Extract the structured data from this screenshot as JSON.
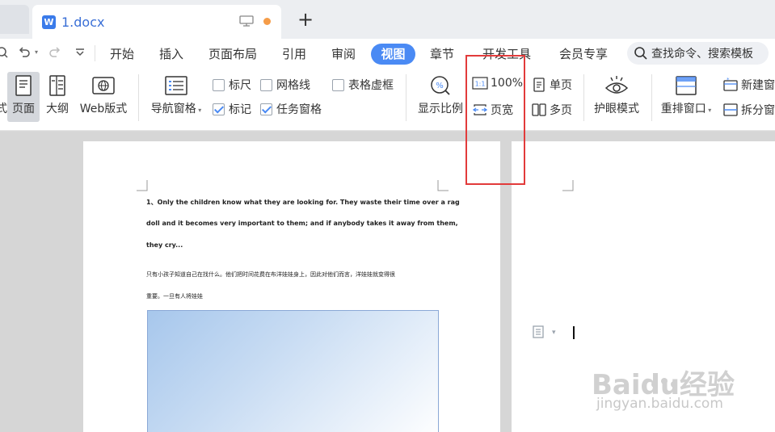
{
  "tabbar": {
    "doc_title": "1.docx",
    "add_tab": "+"
  },
  "menu": {
    "items": [
      "开始",
      "插入",
      "页面布局",
      "引用",
      "审阅",
      "视图",
      "章节",
      "开发工具",
      "会员专享"
    ],
    "active": "视图",
    "search_placeholder": "查找命令、搜索模板"
  },
  "ribbon": {
    "partial_left": "式",
    "page": "页面",
    "outline": "大纲",
    "web": "Web版式",
    "nav_pane": "导航窗格",
    "ruler": "标尺",
    "gridlines": "网格线",
    "table_gridlines": "表格虚框",
    "marks": "标记",
    "task_pane": "任务窗格",
    "zoom": "显示比例",
    "zoom_100": "100%",
    "page_width": "页宽",
    "single_page": "单页",
    "multi_page": "多页",
    "eye_mode": "护眼模式",
    "rearrange": "重排窗口",
    "new_window": "新建窗",
    "split_window": "拆分窗",
    "checks": {
      "ruler": false,
      "gridlines": false,
      "table_gridlines": false,
      "marks": true,
      "task_pane": true
    }
  },
  "document": {
    "en_line1": "1、Only the children know what they are looking for. They waste their time over a rag",
    "en_line2": "doll and it becomes very important to them; and if anybody takes it away from them,",
    "en_line3": "they cry...",
    "cn_line1": "只有小孩子知道自己在找什么。他们把时间花费在布洋娃娃身上，因此对他们而言，洋娃娃就变得很",
    "cn_line2": "重要。一旦有人将娃娃"
  },
  "watermark": {
    "brand": "Baidu经验",
    "url": "jingyan.baidu.com"
  },
  "colors": {
    "accent": "#4a8af4",
    "highlight": "#e23b3b",
    "tab_title": "#3a6fd6"
  }
}
